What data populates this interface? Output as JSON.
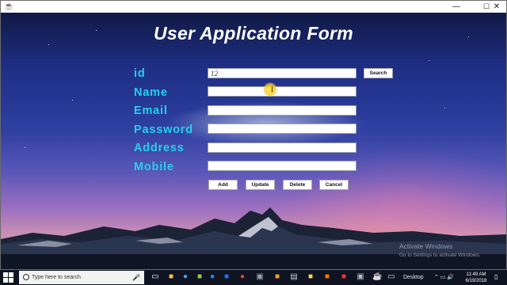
{
  "window": {
    "app_icon": "java-coffee-icon",
    "minimize_icon": "minimize-icon",
    "maximize_icon": "maximize-icon",
    "close_icon": "close-icon"
  },
  "form": {
    "title": "User Application Form",
    "fields": [
      {
        "key": "id",
        "label": "id",
        "value": "12"
      },
      {
        "key": "name",
        "label": "Name",
        "value": ""
      },
      {
        "key": "email",
        "label": "Email",
        "value": ""
      },
      {
        "key": "password",
        "label": "Password",
        "value": ""
      },
      {
        "key": "address",
        "label": "Address",
        "value": ""
      },
      {
        "key": "mobile",
        "label": "Mobile",
        "value": ""
      }
    ],
    "search_label": "Search",
    "buttons": {
      "add": "Add",
      "update": "Update",
      "delete": "Delete",
      "cancel": "Cancel"
    }
  },
  "watermark": {
    "line1": "Activate Windows",
    "line2": "Go to Settings to activate Windows."
  },
  "taskbar": {
    "search_placeholder": "Type here to search",
    "desktop_label": "Desktop",
    "time": "11:49 AM",
    "date": "6/19/2018",
    "icons": [
      "microphone-icon",
      "task-view-icon",
      "file-explorer-icon",
      "edge-icon",
      "chrome-icon",
      "media-icon",
      "store-icon",
      "app-icon",
      "java-icon",
      "cmd-icon",
      "notes-icon"
    ]
  },
  "colors": {
    "label_color": "#25d1ec",
    "title_color": "#ffffff",
    "taskbar_bg": "#101322"
  }
}
